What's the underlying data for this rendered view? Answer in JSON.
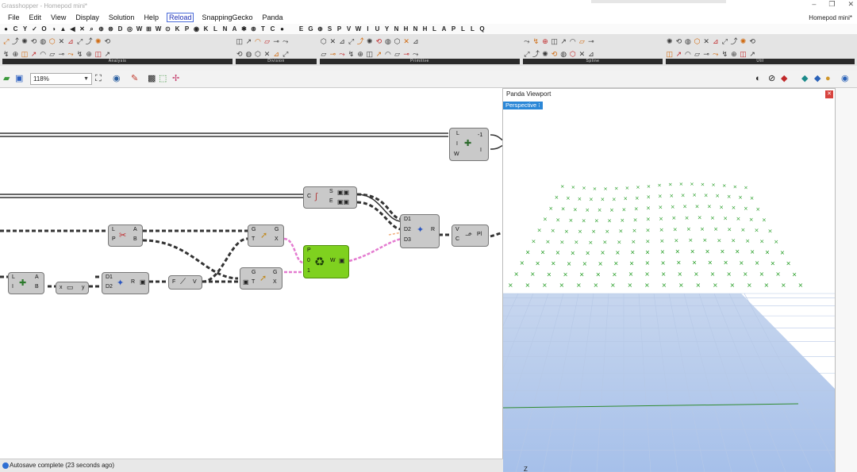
{
  "window": {
    "app_title": "Grasshopper - Homepod mini*",
    "document_name": "Homepod mini*"
  },
  "menu": {
    "items": [
      "File",
      "Edit",
      "View",
      "Display",
      "Solution",
      "Help"
    ],
    "reload": "Reload",
    "extras": [
      "SnappingGecko",
      "Panda"
    ]
  },
  "tabs": [
    "●",
    "C",
    "Y",
    "✓",
    "O",
    "◑",
    "▲",
    "◀",
    "✕",
    "⌕",
    "⊕",
    "⊗",
    "D",
    "◎",
    "W",
    "⊞",
    "W",
    "⊙",
    "K",
    "P",
    "◉",
    "K",
    "L",
    "N",
    "A",
    "✱",
    "⊛",
    "T",
    "C",
    "●",
    "",
    "E",
    "G",
    "⊕",
    "S",
    "P",
    "V",
    "W",
    "I",
    "U",
    "Y",
    "N",
    "H",
    "N",
    "H",
    "L",
    "A",
    "P",
    "L",
    "L",
    "Q"
  ],
  "ribbon_panels": [
    {
      "name": "Analysis",
      "count": 24
    },
    {
      "name": "Division",
      "count": 12
    },
    {
      "name": "Primitive",
      "count": 22
    },
    {
      "name": "Spline",
      "count": 16
    },
    {
      "name": "Util",
      "count": 20
    }
  ],
  "toolbar": {
    "zoom": "118%"
  },
  "canvas": {
    "nodes": {
      "n1": {
        "ports_in": [
          "L",
          "I",
          "W"
        ],
        "ports_out": [
          "-1",
          "I"
        ]
      },
      "n2": {
        "ports_in": [
          "C"
        ],
        "ports_out": [
          "S",
          "E"
        ]
      },
      "n3": {
        "ports_in": [
          "L",
          "P"
        ],
        "ports_out": [
          "A",
          "B"
        ]
      },
      "n4": {
        "ports_in": [
          "G",
          "T"
        ],
        "ports_out": [
          "G",
          "X"
        ]
      },
      "n5": {
        "ports_in": [
          "P",
          "0",
          "1"
        ],
        "ports_out": [
          "W"
        ]
      },
      "n6": {
        "ports_in": [
          "D1",
          "D2",
          "D3"
        ],
        "ports_out": [
          "R"
        ]
      },
      "n7": {
        "ports_in": [
          "V",
          "C"
        ],
        "ports_out": [
          "Pl"
        ]
      },
      "n8": {
        "ports_in": [
          "L",
          "I"
        ],
        "ports_out": [
          "A",
          "B"
        ]
      },
      "n9": {
        "ports_in": [
          "x"
        ],
        "ports_out": [
          "y"
        ]
      },
      "n10": {
        "ports_in": [
          "D1",
          "D2"
        ],
        "ports_out": [
          "R"
        ]
      },
      "n11": {
        "ports_in": [
          "F"
        ],
        "ports_out": [
          "V"
        ]
      },
      "n12": {
        "ports_in": [
          "G",
          "T"
        ],
        "ports_out": [
          "G",
          "X"
        ]
      }
    }
  },
  "viewport": {
    "title": "Panda Viewport",
    "label": "Perspective",
    "axis_label": "Z"
  },
  "status": {
    "autosave": "Autosave complete (23 seconds ago)"
  },
  "colors": {
    "point_color": "#1e9a1e",
    "grid_bg": "#a9c3ea",
    "sky": "#ffffff",
    "node_green": "#7fd11f"
  }
}
